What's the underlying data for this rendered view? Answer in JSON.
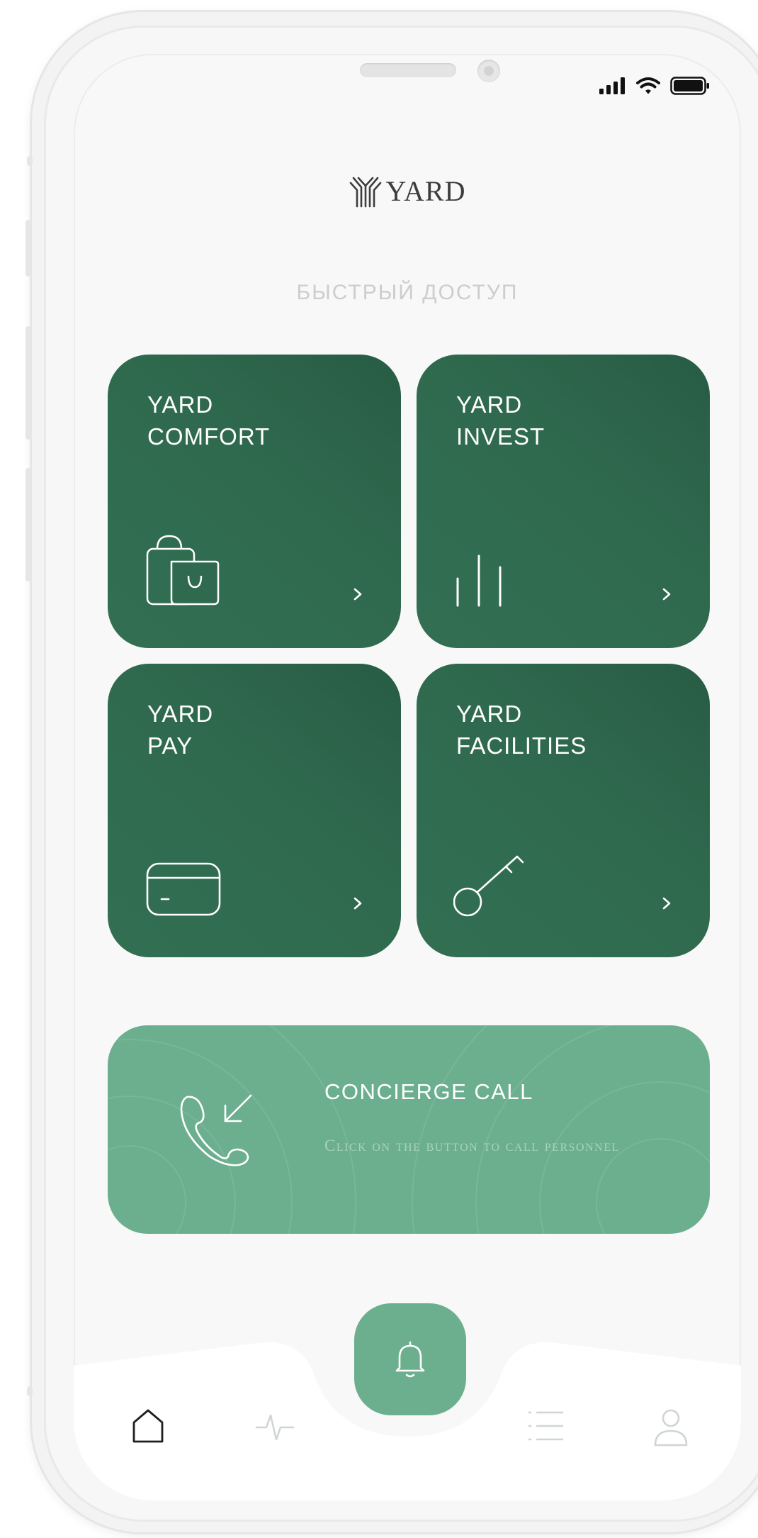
{
  "app": {
    "logo_text": "YARD"
  },
  "section": {
    "title": "БЫСТРЫЙ ДОСТУП"
  },
  "tiles": [
    {
      "line1": "YARD",
      "line2": "COMFORT",
      "icon": "shopping-bags-icon"
    },
    {
      "line1": "YARD",
      "line2": "INVEST",
      "icon": "bar-chart-icon"
    },
    {
      "line1": "YARD",
      "line2": "PAY",
      "icon": "credit-card-icon"
    },
    {
      "line1": "YARD",
      "line2": "FACILITIES",
      "icon": "key-icon"
    }
  ],
  "concierge": {
    "title": "CONCIERGE CALL",
    "subtitle": "Click on the button to call personnel",
    "icon": "incoming-call-icon"
  },
  "tabbar": {
    "items": [
      {
        "icon": "home-icon",
        "active": true
      },
      {
        "icon": "activity-icon",
        "active": false
      },
      {
        "icon": "bell-icon",
        "active": false
      },
      {
        "icon": "list-icon",
        "active": false
      },
      {
        "icon": "user-icon",
        "active": false
      }
    ]
  },
  "colors": {
    "tile_green": "#2f6a4e",
    "concierge_green": "#6caf8e",
    "screen_bg": "#f8f8f8"
  }
}
